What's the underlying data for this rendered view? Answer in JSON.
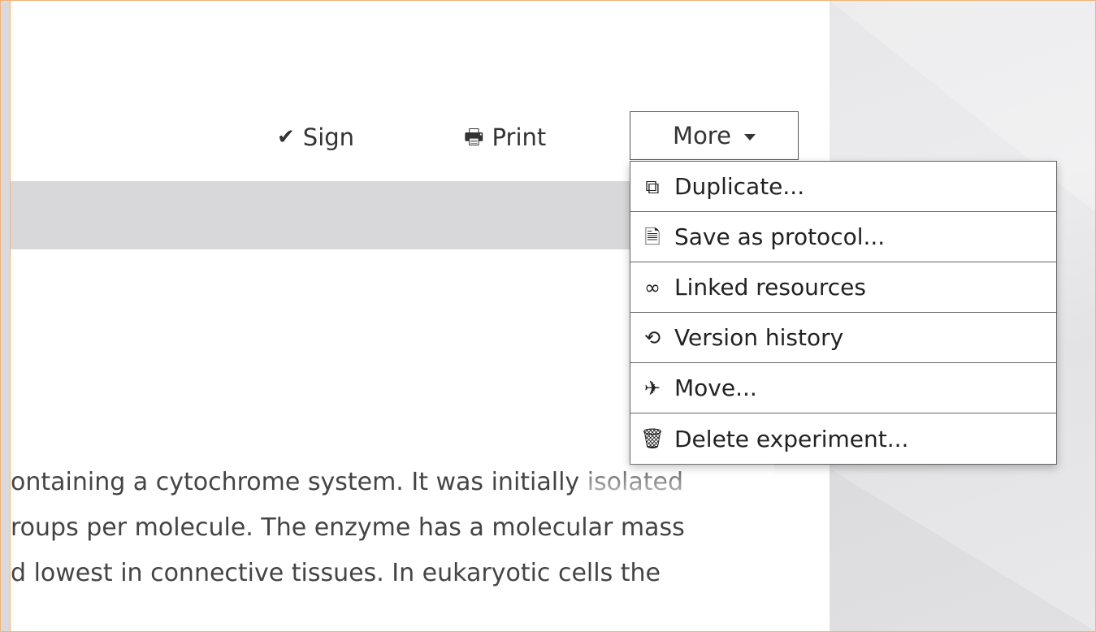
{
  "toolbar": {
    "sign": {
      "icon": "checkmark-icon",
      "label": "Sign"
    },
    "print": {
      "icon": "printer-icon",
      "label": "Print"
    },
    "more": {
      "label": "More",
      "icon": "caret-down-icon"
    }
  },
  "menu": {
    "items": [
      {
        "icon": "duplicate-icon",
        "glyph": "⧉",
        "label": "Duplicate..."
      },
      {
        "icon": "document-icon",
        "glyph": "🗎",
        "label": "Save as protocol..."
      },
      {
        "icon": "link-icon",
        "glyph": "∞",
        "label": "Linked resources"
      },
      {
        "icon": "history-icon",
        "glyph": "⟲",
        "label": "Version history"
      },
      {
        "icon": "plane-icon",
        "glyph": "✈",
        "label": "Move..."
      },
      {
        "icon": "trash-icon",
        "glyph": "🗑",
        "label": "Delete experiment..."
      }
    ]
  },
  "content": {
    "lines": [
      "ontaining a cytochrome system. It was initially isolated",
      "roups per molecule. The enzyme has a molecular mass",
      "d lowest in connective tissues. In eukaryotic cells the"
    ]
  },
  "colors": {
    "frame_border": "#f3b27a",
    "gray_bar": "#d8d8da",
    "menu_border": "#666666"
  }
}
